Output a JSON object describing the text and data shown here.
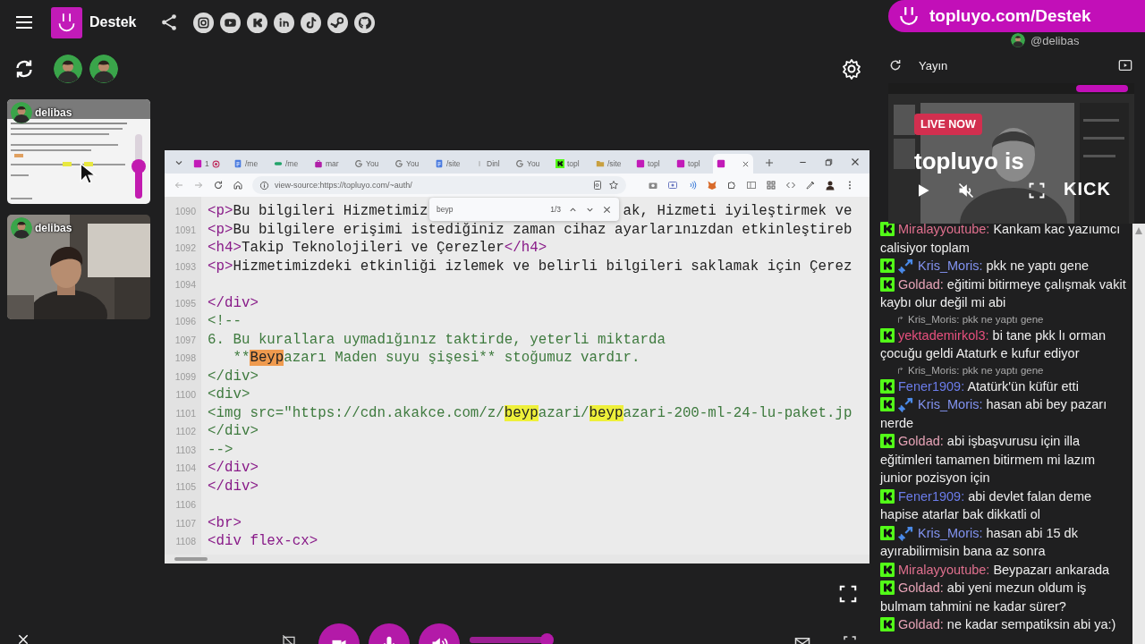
{
  "topbar": {
    "title": "Destek"
  },
  "promo": {
    "text": "topluyo.com/Destek",
    "handle": "@delibas"
  },
  "stream": {
    "title": "Yayın",
    "badge": "LIVE NOW",
    "headline": "topluyo is",
    "platform": "KICK"
  },
  "video_tiles": [
    {
      "kind": "screen",
      "name": "delibas",
      "volume": {
        "level": 0.5
      }
    },
    {
      "kind": "camera",
      "name": "delibas"
    }
  ],
  "browser": {
    "tabs": [
      {
        "kind": "record",
        "label": "1",
        "selected": false
      },
      {
        "kind": "doc",
        "label": "/me",
        "selected": false
      },
      {
        "kind": "green",
        "label": "/me",
        "selected": false
      },
      {
        "kind": "bag",
        "label": "mar",
        "selected": false
      },
      {
        "kind": "g",
        "label": "You",
        "selected": false
      },
      {
        "kind": "g",
        "label": "You",
        "selected": false
      },
      {
        "kind": "doc",
        "label": "/site",
        "selected": false
      },
      {
        "kind": "blank",
        "label": "Dinl",
        "selected": false
      },
      {
        "kind": "g",
        "label": "You",
        "selected": false
      },
      {
        "kind": "kick",
        "label": "topl",
        "selected": false
      },
      {
        "kind": "folder",
        "label": "/site",
        "selected": false
      },
      {
        "kind": "app",
        "label": "topl",
        "selected": false
      },
      {
        "kind": "app",
        "label": "topl",
        "selected": false
      },
      {
        "kind": "app",
        "selected": true
      }
    ],
    "address": "view-source:https://topluyo.com/~auth/",
    "find": {
      "query": "beyp",
      "count": "1/3"
    },
    "lines": [
      {
        "number": "1090",
        "segments": [
          {
            "kind": "tag",
            "text": "<p>"
          },
          {
            "kind": "text",
            "text": "Bu bilgileri Hizmetimiz"
          }
        ],
        "after_find": [
          {
            "kind": "text",
            "text": "ak, Hizmeti iyileştirmek ve"
          }
        ]
      },
      {
        "number": "1091",
        "segments": [
          {
            "kind": "tag",
            "text": "<p>"
          },
          {
            "kind": "text",
            "text": "Bu bilgilere erişimi istediğiniz zaman cihaz ayarlarınızdan etkinleştireb"
          }
        ]
      },
      {
        "number": "1092",
        "segments": [
          {
            "kind": "tag",
            "text": "<h4>"
          },
          {
            "kind": "text",
            "text": "Takip Teknolojileri ve Çerezler"
          },
          {
            "kind": "tag",
            "text": "</h4>"
          }
        ]
      },
      {
        "number": "1093",
        "segments": [
          {
            "kind": "tag",
            "text": "<p>"
          },
          {
            "kind": "text",
            "text": "Hizmetimizdeki etkinliği izlemek ve belirli bilgileri saklamak için Çerez"
          }
        ]
      },
      {
        "number": "1094"
      },
      {
        "number": "1095",
        "segments": [
          {
            "kind": "tag",
            "text": "</div>"
          }
        ]
      },
      {
        "number": "1096",
        "segments": [
          {
            "kind": "comment",
            "text": "<!--"
          }
        ]
      },
      {
        "number": "1097",
        "segments": [
          {
            "kind": "comment",
            "text": "6. Bu kurallara uymadığınız taktirde, yeterli miktarda"
          }
        ]
      },
      {
        "number": "1098",
        "segments": [
          {
            "kind": "comment",
            "text": "   **"
          },
          {
            "kind": "current",
            "text": "Beyp"
          },
          {
            "kind": "comment",
            "text": "azarı Maden suyu şişesi** stoğumuz vardır."
          }
        ]
      },
      {
        "number": "1099",
        "segments": [
          {
            "kind": "comment",
            "text": "</div>"
          }
        ]
      },
      {
        "number": "1100",
        "segments": [
          {
            "kind": "comment",
            "text": "<div>"
          }
        ]
      },
      {
        "number": "1101",
        "segments": [
          {
            "kind": "comment",
            "text": "<img src=\"https://cdn.akakce.com/z/"
          },
          {
            "kind": "match",
            "text": "beyp"
          },
          {
            "kind": "comment",
            "text": "azari/"
          },
          {
            "kind": "match",
            "text": "beyp"
          },
          {
            "kind": "comment",
            "text": "azari-200-ml-24-lu-paket.jp"
          }
        ]
      },
      {
        "number": "1102",
        "segments": [
          {
            "kind": "comment",
            "text": "</div>"
          }
        ]
      },
      {
        "number": "1103",
        "segments": [
          {
            "kind": "comment",
            "text": "-->"
          }
        ]
      },
      {
        "number": "1104",
        "segments": [
          {
            "kind": "tag",
            "text": "</div>"
          }
        ]
      },
      {
        "number": "1105",
        "segments": [
          {
            "kind": "tag",
            "text": "</div>"
          }
        ]
      },
      {
        "number": "1106"
      },
      {
        "number": "1107",
        "segments": [
          {
            "kind": "tag",
            "text": "<br>"
          }
        ]
      },
      {
        "number": "1108",
        "segments": [
          {
            "kind": "tag",
            "text": "<div flex-cx>"
          }
        ]
      }
    ]
  },
  "controls": {
    "volume": {
      "level": 0.97
    }
  },
  "chat": {
    "messages": [
      {
        "user": "Miralayyoutube:",
        "color": "#e0708e",
        "moderator": false,
        "text": "Kankam kac yazıumcı calisiyor toplam"
      },
      {
        "user": "Kris_Moris:",
        "color": "#8293f0",
        "moderator": true,
        "text": "pkk ne yaptı gene"
      },
      {
        "user": "Goldad:",
        "color": "#e6a3b6",
        "moderator": false,
        "text": "eğitimi bitirmeye çalışmak vakit kaybı olur değil mi abi"
      },
      {
        "user": "yektademirkol3:",
        "color": "#e8507e",
        "moderator": false,
        "text": "bi tane pkk lı orman çocuğu geldi Ataturk e kufur ediyor",
        "reply": "Kris_Moris: pkk ne yaptı gene"
      },
      {
        "user": "Fener1909:",
        "color": "#6b7cea",
        "moderator": false,
        "text": "Atatürk'ün küfür etti",
        "reply": "Kris_Moris: pkk ne yaptı gene"
      },
      {
        "user": "Kris_Moris:",
        "color": "#8293f0",
        "moderator": true,
        "text": "hasan abi bey pazarı nerde"
      },
      {
        "user": "Goldad:",
        "color": "#e6a3b6",
        "moderator": false,
        "text": "abi işbaşvurusu için illa eğitimleri tamamen bitirmem mi lazım junior pozisyon için"
      },
      {
        "user": "Fener1909:",
        "color": "#6b7cea",
        "moderator": false,
        "text": "abi devlet falan deme hapise atarlar bak dikkatli ol"
      },
      {
        "user": "Kris_Moris:",
        "color": "#8293f0",
        "moderator": true,
        "text": "hasan abi 15 dk ayırabilirmisin bana az sonra"
      },
      {
        "user": "Miralayyoutube:",
        "color": "#e0708e",
        "moderator": false,
        "text": "Beypazarı ankarada"
      },
      {
        "user": "Goldad:",
        "color": "#e6a3b6",
        "moderator": false,
        "text": "abi yeni mezun oldum iş bulmam tahmini ne kadar sürer?"
      },
      {
        "user": "Goldad:",
        "color": "#e6a3b6",
        "moderator": false,
        "text": "ne kadar sempatiksin abi ya:)"
      }
    ]
  }
}
